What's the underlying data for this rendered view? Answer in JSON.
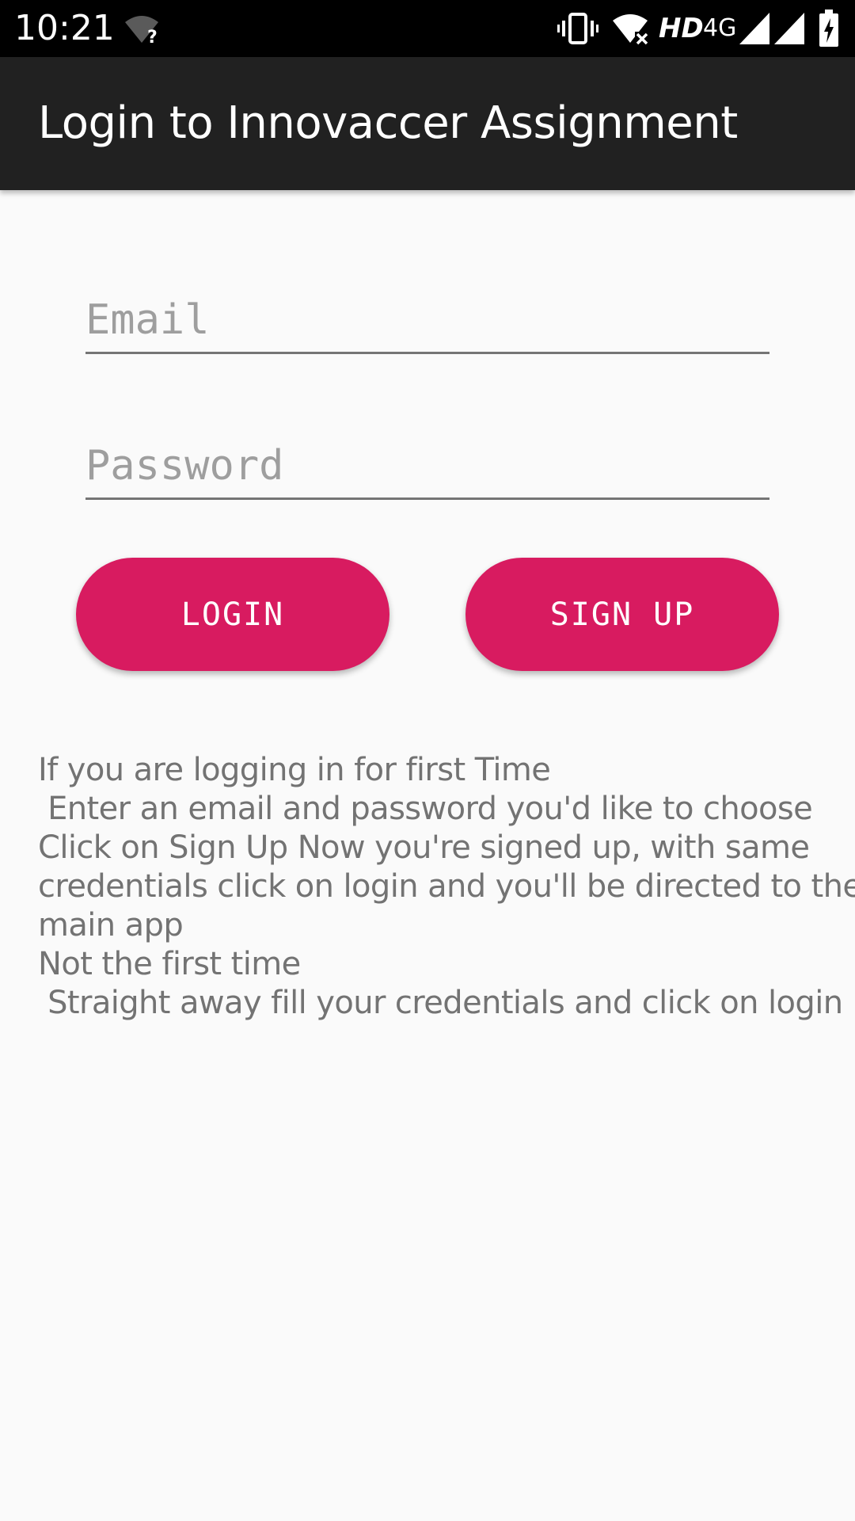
{
  "status_bar": {
    "time": "10:21",
    "hd_label": "HD",
    "network_label": "4G",
    "icons": [
      "wifi-unknown-icon",
      "vibrate-icon",
      "wifi-x-icon",
      "signal-icon",
      "signal-icon",
      "battery-charging-icon"
    ]
  },
  "app_bar": {
    "title": "Login to Innovaccer Assignment",
    "background": "#212121"
  },
  "form": {
    "email_placeholder": "Email",
    "email_value": "",
    "password_placeholder": "Password",
    "password_value": ""
  },
  "buttons": {
    "login_label": "LOGIN",
    "signup_label": "SIGN UP",
    "color": "#d81b60"
  },
  "instructions": {
    "lines": [
      "If you are logging in for first Time",
      " Enter an email and password you'd like to choose",
      "Click on Sign Up Now you're signed up, with same",
      "credentials click on login and you'll be directed to the",
      "main app",
      "Not the first time",
      " Straight away fill your credentials and click on login"
    ]
  }
}
